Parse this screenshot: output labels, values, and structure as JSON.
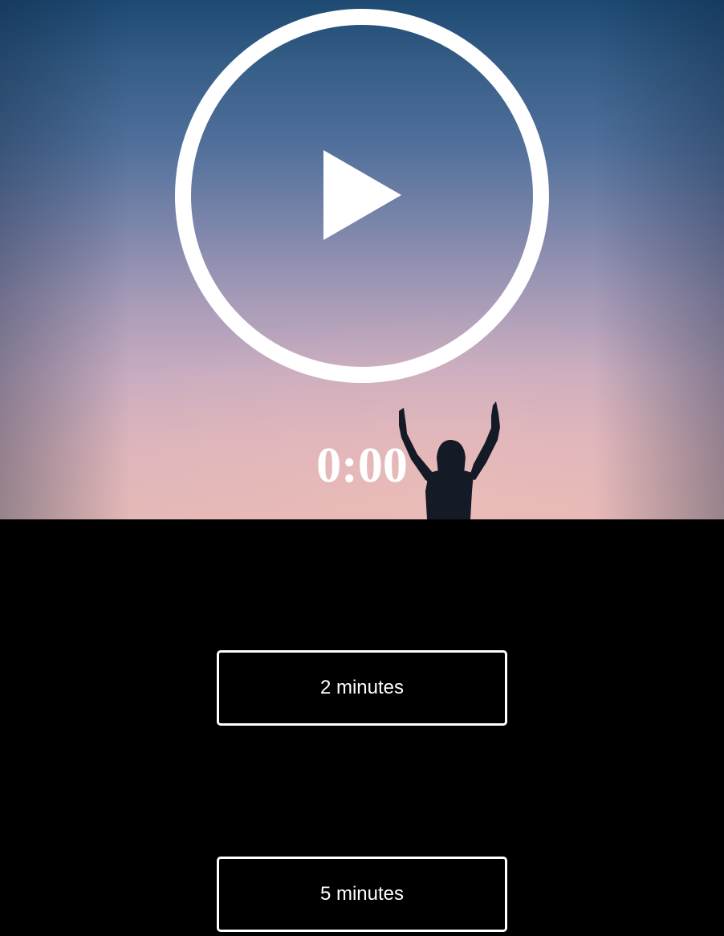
{
  "player": {
    "play_icon": "play-circle-icon",
    "timer": "0:00"
  },
  "durations": [
    {
      "label": "2 minutes"
    },
    {
      "label": "5 minutes"
    }
  ],
  "colors": {
    "background": "#000000",
    "foreground": "#ffffff",
    "sky_top": "#1d4a72",
    "sky_bottom": "#e3b8b6"
  }
}
